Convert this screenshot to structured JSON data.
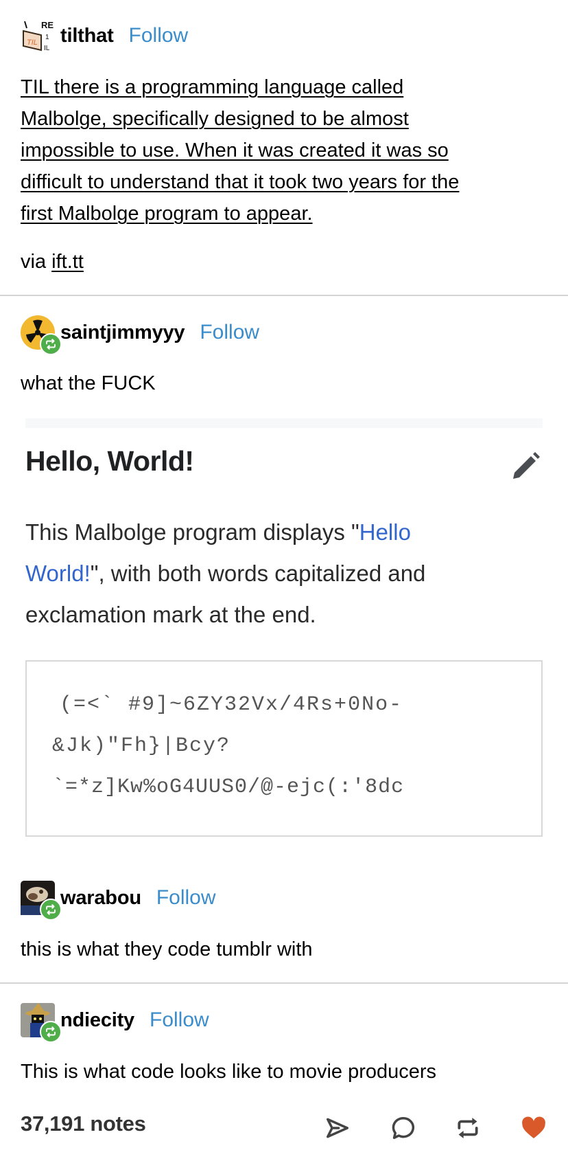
{
  "posts": [
    {
      "username": "tilthat",
      "follow_label": "Follow",
      "avatar_icon": "til-logo-avatar",
      "reblogged": false,
      "body": "TIL there is a programming language called Malbolge, specifically designed to be almost impossible to use. When it was created it was so difficult to understand that it took two years for the first Malbolge program to appear.",
      "body_lines": [
        "TIL there is a programming language called",
        "Malbolge, specifically designed to be almost",
        "impossible to use. When it was created it was so",
        "difficult to understand that it took two years for the",
        "first Malbolge program to appear."
      ],
      "via_prefix": "via",
      "via_link": "ift.tt"
    },
    {
      "username": "saintjimmyyy",
      "follow_label": "Follow",
      "avatar_icon": "radiation-symbol-avatar",
      "reblogged": true,
      "body": "what the FUCK",
      "embed": {
        "title": "Hello, World!",
        "edit_icon": "pencil-icon",
        "paragraph_before_link": "This Malbolge program displays \"",
        "paragraph_link": "Hello World!",
        "paragraph_after_link": "\", with both words capitalized and exclamation mark at the end.",
        "para_line1_a": "This Malbolge program displays \"",
        "para_line1_link": "Hello",
        "para_line2_link": "World!",
        "para_line2_b": "\", with both words capitalized and",
        "para_line3": "exclamation mark at the end.",
        "code_lines": [
          " (=<` #9]~6ZY32Vx/4Rs+0No-",
          "&Jk)\"Fh}|Bcy?",
          "`=*z]Kw%oG4UUS0/@-ejc(:'8dc"
        ]
      }
    },
    {
      "username": "warabou",
      "follow_label": "Follow",
      "avatar_icon": "dog-photo-avatar",
      "reblogged": true,
      "body": "this is what they code tumblr with"
    },
    {
      "username": "ndiecity",
      "follow_label": "Follow",
      "avatar_icon": "black-mage-avatar",
      "reblogged": true,
      "body": "This is what code looks like to movie producers"
    }
  ],
  "footer": {
    "notes": "37,191 notes",
    "actions": [
      {
        "name": "share",
        "icon": "send-icon"
      },
      {
        "name": "reply",
        "icon": "comment-icon"
      },
      {
        "name": "reblog",
        "icon": "reblog-icon"
      },
      {
        "name": "like",
        "icon": "heart-icon",
        "active": true
      }
    ]
  },
  "colors": {
    "follow": "#3a8ccb",
    "reblog_badge": "#4fae4a",
    "heart": "#d9592a",
    "wiki_link": "#3366cc",
    "icon_gray": "#444444"
  }
}
